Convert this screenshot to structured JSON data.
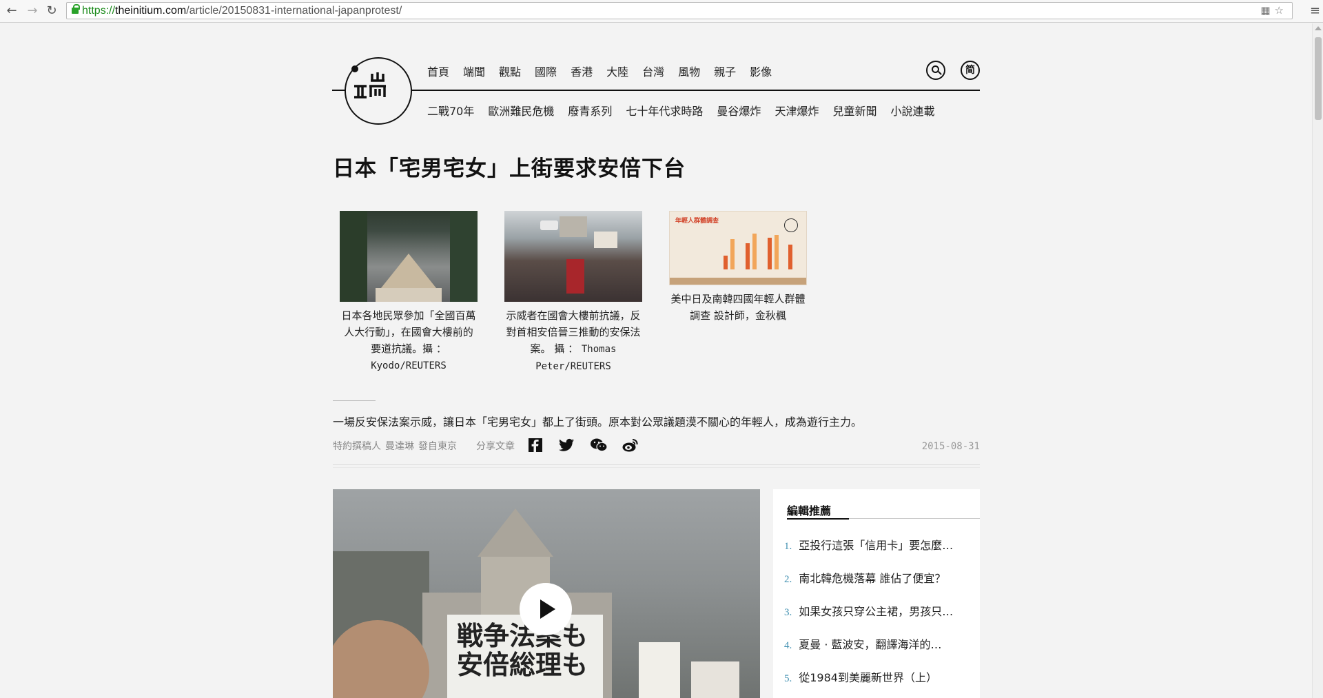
{
  "browser": {
    "url_scheme": "https://",
    "url_host": "theinitium.com",
    "url_path": "/article/20150831-international-japanprotest/"
  },
  "header": {
    "main_nav": [
      "首頁",
      "端聞",
      "觀點",
      "國際",
      "香港",
      "大陸",
      "台灣",
      "風物",
      "親子",
      "影像"
    ],
    "sub_nav": [
      "二戰70年",
      "歐洲難民危機",
      "廢青系列",
      "七十年代求時路",
      "曼谷爆炸",
      "天津爆炸",
      "兒童新聞",
      "小說連載"
    ],
    "lang_button": "简"
  },
  "article": {
    "title": "日本「宅男宅女」上街要求安倍下台",
    "gallery": [
      {
        "caption": "日本各地民眾參加「全國百萬人大行動」，在國會大樓前的要道抗議。攝 ：",
        "credit": "Kyodo/REUTERS"
      },
      {
        "caption": "示威者在國會大樓前抗議，反對首相安倍晉三推動的安保法案。 攝 ：",
        "credit": "Thomas Peter/REUTERS"
      },
      {
        "caption": "美中日及南韓四國年輕人群體調查 設計師，金秋楓",
        "credit": "",
        "chart_title": "年輕人群體調查"
      }
    ],
    "lead": "一場反安保法案示威，讓日本「宅男宅女」都上了街頭。原本對公眾議題漠不關心的年輕人，成為遊行主力。",
    "meta": {
      "role": "特約撰稿人",
      "author": "曼達琳",
      "location": "發自東京",
      "share_label": "分享文章",
      "date": "2015-08-31"
    },
    "video_sign_text": [
      "戦争法案も",
      "安倍総理も"
    ]
  },
  "sidebar": {
    "title": "編輯推薦",
    "items": [
      {
        "num": "1.",
        "text": "亞投行這張「信用卡」要怎麼…"
      },
      {
        "num": "2.",
        "text": "南北韓危機落幕 誰佔了便宜？"
      },
      {
        "num": "3.",
        "text": "如果女孩只穿公主裙，男孩只…"
      },
      {
        "num": "4.",
        "text": "夏曼 · 藍波安，翻譯海洋的…"
      },
      {
        "num": "5.",
        "text": "從1984到美麗新世界（上）"
      }
    ]
  },
  "colors": {
    "accent_number": "#3f8fb0",
    "chart_bar_dark": "#e0602e",
    "chart_bar_light": "#f2a65a"
  }
}
